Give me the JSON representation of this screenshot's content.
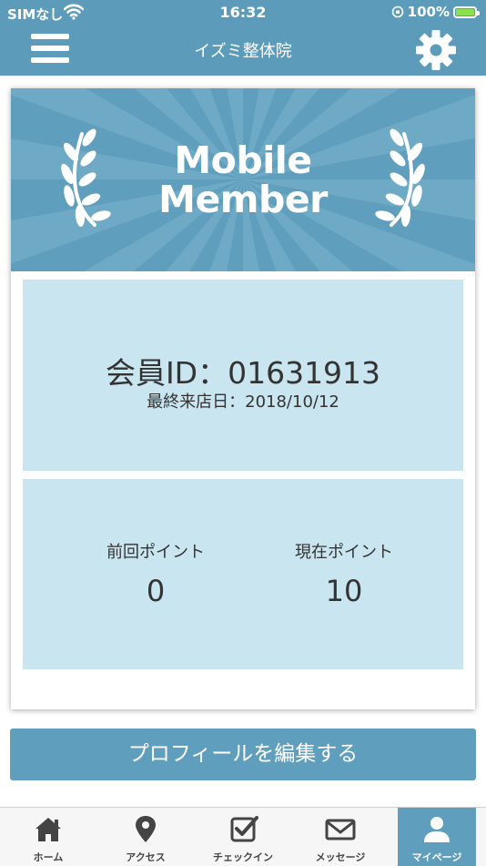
{
  "status_bar": {
    "carrier": "SIMなし",
    "time": "16:32",
    "battery": "100%"
  },
  "header": {
    "title": "イズミ整体院"
  },
  "card": {
    "banner_line1": "Mobile",
    "banner_line2": "Member",
    "member_id": "会員ID：01631913",
    "last_visit": "最終来店日：2018/10/12",
    "previous_points_label": "前回ポイント",
    "previous_points_value": "0",
    "current_points_label": "現在ポイント",
    "current_points_value": "10"
  },
  "edit_profile_label": "プロフィールを編集する",
  "tabs": [
    {
      "label": "ホーム",
      "icon": "home-icon"
    },
    {
      "label": "アクセス",
      "icon": "map-pin-icon"
    },
    {
      "label": "チェックイン",
      "icon": "checkbox-icon"
    },
    {
      "label": "メッセージ",
      "icon": "envelope-icon"
    },
    {
      "label": "マイページ",
      "icon": "user-icon"
    }
  ],
  "colors": {
    "accent": "#5f9fbd",
    "panel": "#c9e5ef",
    "battery_fill": "#8be04e"
  }
}
